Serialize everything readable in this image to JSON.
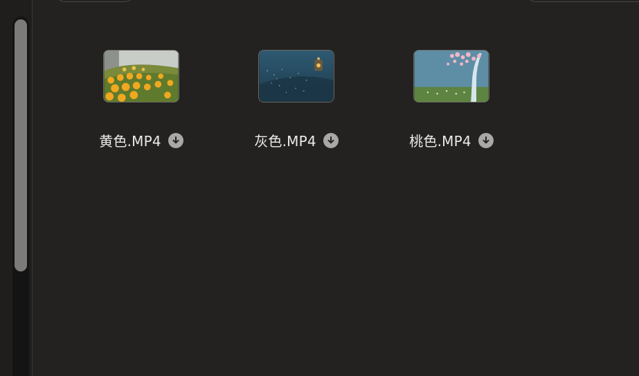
{
  "files": [
    {
      "name": "黄色.MP4",
      "thumb_icon": "yellow-flower-field-thumbnail"
    },
    {
      "name": "灰色.MP4",
      "thumb_icon": "dark-blue-night-thumbnail"
    },
    {
      "name": "桃色.MP4",
      "thumb_icon": "peach-blossom-tree-thumbnail"
    }
  ],
  "colors": {
    "background": "#232221",
    "text": "#ecebea",
    "download_badge": "#a9a8a6",
    "scroll_thumb": "#7c7b79"
  }
}
